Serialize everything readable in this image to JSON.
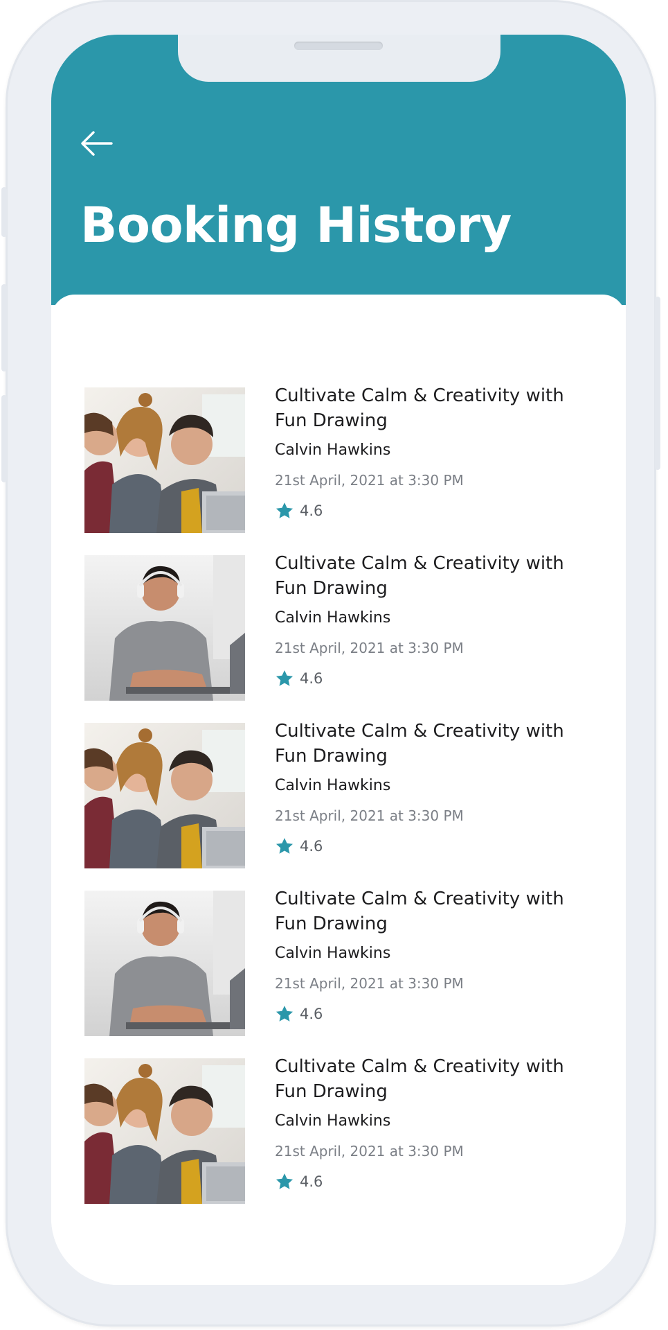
{
  "header": {
    "title": "Booking History",
    "back_icon": "arrow-left-icon"
  },
  "colors": {
    "accent": "#2b97aa",
    "text_primary": "#1d1d1f",
    "text_secondary": "#7b7f86",
    "star": "#2b97aa"
  },
  "bookings": [
    {
      "title": "Cultivate Calm & Creativity with Fun Drawing",
      "instructor": "Calvin Hawkins",
      "datetime": "21st April, 2021 at 3:30 PM",
      "rating": "4.6",
      "image": "group-of-students-photo"
    },
    {
      "title": "Cultivate Calm & Creativity with Fun Drawing",
      "instructor": "Calvin Hawkins",
      "datetime": "21st April, 2021 at 3:30 PM",
      "rating": "4.6",
      "image": "man-with-headphones-photo"
    },
    {
      "title": "Cultivate Calm & Creativity with Fun Drawing",
      "instructor": "Calvin Hawkins",
      "datetime": "21st April, 2021 at 3:30 PM",
      "rating": "4.6",
      "image": "group-of-students-photo"
    },
    {
      "title": "Cultivate Calm & Creativity with Fun Drawing",
      "instructor": "Calvin Hawkins",
      "datetime": "21st April, 2021 at 3:30 PM",
      "rating": "4.6",
      "image": "man-with-headphones-photo"
    },
    {
      "title": "Cultivate Calm & Creativity with Fun Drawing",
      "instructor": "Calvin Hawkins",
      "datetime": "21st April, 2021 at 3:30 PM",
      "rating": "4.6",
      "image": "group-of-students-photo"
    }
  ]
}
